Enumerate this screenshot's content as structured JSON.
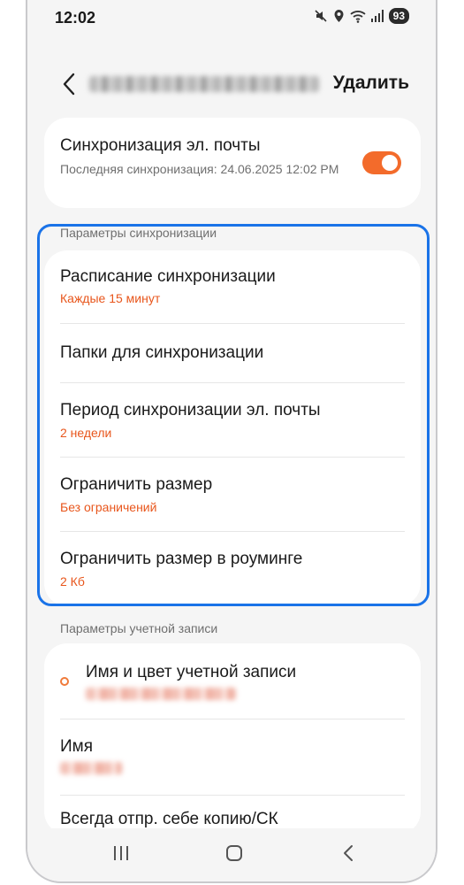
{
  "status_bar": {
    "time": "12:02",
    "icons": [
      "mute-icon",
      "location-icon",
      "wifi-icon",
      "signal-icon"
    ],
    "battery": "93"
  },
  "header": {
    "back_icon": "chevron-left-icon",
    "delete_label": "Удалить"
  },
  "email_sync": {
    "title": "Синхронизация эл. почты",
    "subtitle": "Последняя синхронизация: 24.06.2025 12:02 PM",
    "enabled": true
  },
  "sync_settings": {
    "section_label": "Параметры синхронизации",
    "items": [
      {
        "title": "Расписание синхронизации",
        "value": "Каждые 15 минут"
      },
      {
        "title": "Папки для синхронизации",
        "value": ""
      },
      {
        "title": "Период синхронизации эл. почты",
        "value": "2 недели"
      },
      {
        "title": "Ограничить размер",
        "value": "Без ограничений"
      },
      {
        "title": "Ограничить размер в роуминге",
        "value": "2 Кб"
      }
    ]
  },
  "account_settings": {
    "section_label": "Параметры учетной записи",
    "items": [
      {
        "title": "Имя и цвет учетной записи"
      },
      {
        "title": "Имя"
      },
      {
        "title": "Всегда отпр. себе копию/СК"
      }
    ]
  },
  "nav_bar": {
    "buttons": [
      "recents-icon",
      "home-icon",
      "back-icon"
    ]
  },
  "colors": {
    "accent": "#f36b2b",
    "value_text": "#e8561c",
    "highlight": "#1a73e8",
    "background": "#f5f5f5"
  }
}
